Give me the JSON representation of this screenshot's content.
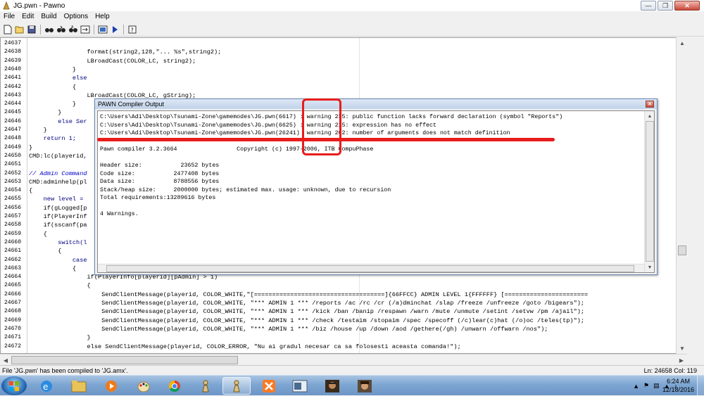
{
  "window": {
    "title": "JG.pwn - Pawno"
  },
  "menu": [
    "File",
    "Edit",
    "Build",
    "Options",
    "Help"
  ],
  "toolbar_icons": [
    "new-file-icon",
    "open-folder-icon",
    "save-icon",
    "find-icon",
    "find-next-icon",
    "replace-icon",
    "goto-icon",
    "compile-icon",
    "run-icon",
    "help-icon"
  ],
  "editor": {
    "lines": [
      {
        "n": "24637",
        "code": ""
      },
      {
        "n": "24638",
        "code": "                format(string2,128,\"... %s\",string2);"
      },
      {
        "n": "24639",
        "code": "                LBroadCast(COLOR_LC, string2);"
      },
      {
        "n": "24640",
        "code": "            }"
      },
      {
        "n": "24641",
        "code": "            else"
      },
      {
        "n": "24642",
        "code": "            {"
      },
      {
        "n": "24643",
        "code": "                LBroadCast(COLOR_LC, gString);"
      },
      {
        "n": "24644",
        "code": "            }"
      },
      {
        "n": "24645",
        "code": "        }"
      },
      {
        "n": "24646",
        "code": "        else Ser"
      },
      {
        "n": "24647",
        "code": "    }"
      },
      {
        "n": "24648",
        "code": "    return 1;"
      },
      {
        "n": "24649",
        "code": "}"
      },
      {
        "n": "24650",
        "code": "CMD:lc(playerid,"
      },
      {
        "n": "24651",
        "code": ""
      },
      {
        "n": "24652",
        "code": "// Admin Command"
      },
      {
        "n": "24653",
        "code": "CMD:adminhelp(pl"
      },
      {
        "n": "24654",
        "code": "{"
      },
      {
        "n": "24655",
        "code": "    new level ="
      },
      {
        "n": "24656",
        "code": "    if(gLogged[p"
      },
      {
        "n": "24657",
        "code": "    if(PlayerInf"
      },
      {
        "n": "24658",
        "code": "    if(sscanf(pa"
      },
      {
        "n": "24659",
        "code": "    {"
      },
      {
        "n": "24660",
        "code": "        switch(l"
      },
      {
        "n": "24661",
        "code": "        {"
      },
      {
        "n": "24662",
        "code": "            case"
      },
      {
        "n": "24663",
        "code": "            {"
      },
      {
        "n": "24664",
        "code": "                if(PlayerInfo[playerid][pAdmin] > 1)"
      },
      {
        "n": "24665",
        "code": "                {"
      },
      {
        "n": "24666",
        "code": "                    SendClientMessage(playerid, COLOR_WHITE,\"[====================================]{66FFCC} ADMIN LEVEL 1{FFFFFF} [======================="
      },
      {
        "n": "24667",
        "code": "                    SendClientMessage(playerid, COLOR_WHITE, \"*** ADMIN 1 *** /reports /ac /rc /cr (/a)dminchat /slap /freeze /unfreeze /goto /bigears\");"
      },
      {
        "n": "24668",
        "code": "                    SendClientMessage(playerid, COLOR_WHITE, \"*** ADMIN 1 *** /kick /ban /banip /respawn /warn /mute /unmute /setint /setvw /pm /ajail\");"
      },
      {
        "n": "24669",
        "code": "                    SendClientMessage(playerid, COLOR_WHITE, \"*** ADMIN 1 *** /check /testaim /stopaim /spec /specoff (/c)lear(c)hat (/o)oc /teles(tp)\");"
      },
      {
        "n": "24670",
        "code": "                    SendClientMessage(playerid, COLOR_WHITE, \"*** ADMIN 1 *** /biz /house /up /down /aod /gethere(/gh) /unwarn /offwarn /nos\");"
      },
      {
        "n": "24671",
        "code": "                }"
      },
      {
        "n": "24672",
        "code": "                else SendClientMessage(playerid, COLOR_ERROR, \"Nu ai gradul necesar ca sa folosesti aceasta comanda!\");"
      }
    ]
  },
  "compiler_dialog": {
    "title": "PAWN Compiler Output",
    "lines": [
      "C:\\Users\\Adi\\Desktop\\Tsunami-Zone\\gamemodes\\JG.pwn(6617) : warning 235: public function lacks forward declaration (symbol \"Reports\")",
      "C:\\Users\\Adi\\Desktop\\Tsunami-Zone\\gamemodes\\JG.pwn(6625) : warning 215: expression has no effect",
      "C:\\Users\\Adi\\Desktop\\Tsunami-Zone\\gamemodes\\JG.pwn(26241)  warning 202: number of arguments does not match definition",
      "",
      "Pawn compiler 3.2.3664                 Copyright (c) 1997-2006, ITB CompuPhase",
      "",
      "Header size:           23652 bytes",
      "Code size:           2477408 bytes",
      "Data size:           8788556 bytes",
      "Stack/heap size:     2000000 bytes; estimated max. usage: unknown, due to recursion",
      "Total requirements:13289616 bytes",
      "",
      "4 Warnings."
    ]
  },
  "statusbar": {
    "message": "File 'JG.pwn' has been compiled to 'JG.amx'.",
    "position": "Ln: 24658   Col: 119"
  },
  "taskbar": {
    "time": "6:24 AM",
    "date": "12/18/2016"
  },
  "colors": {
    "highlight": "#e81c1c",
    "keyword": "#00007f",
    "comment": "#0000c0"
  }
}
